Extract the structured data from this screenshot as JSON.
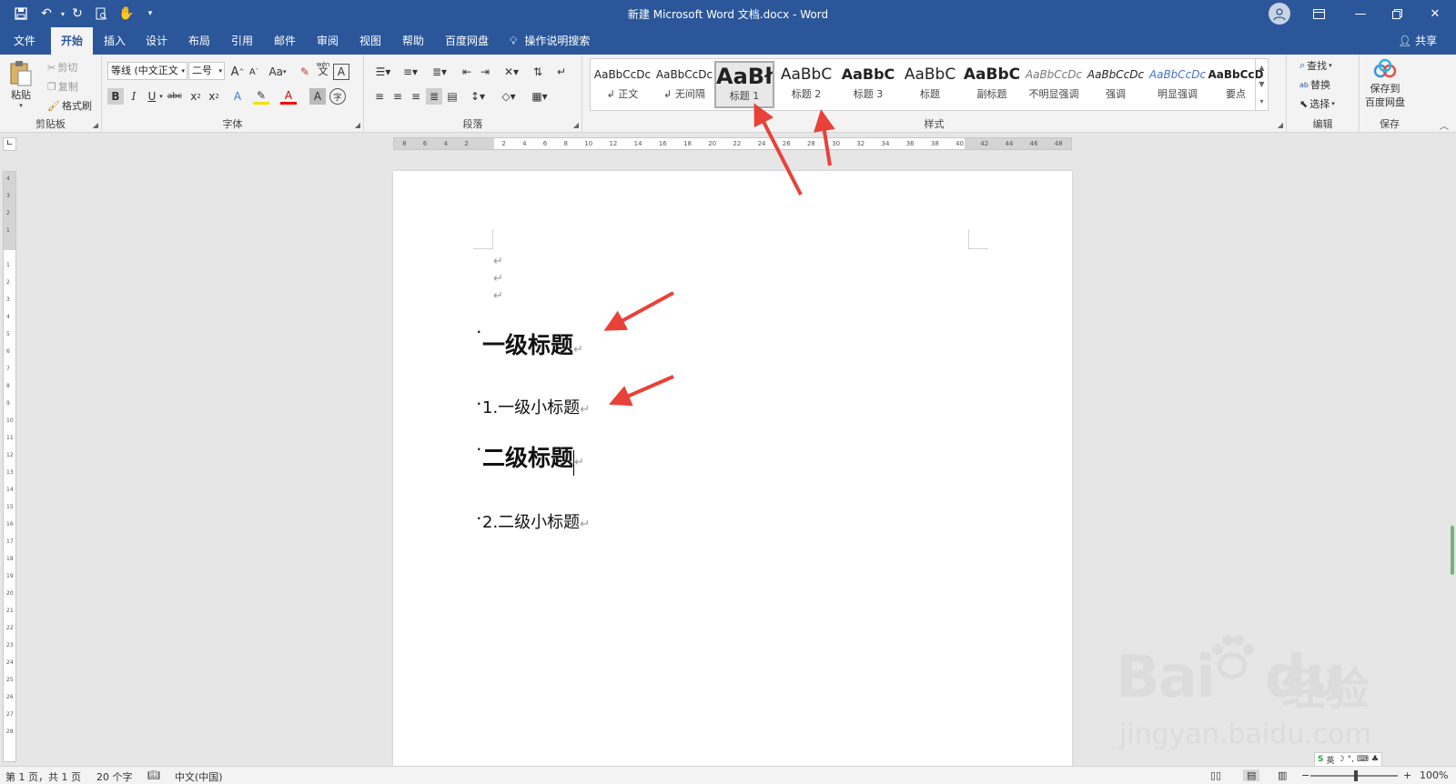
{
  "window": {
    "title": "新建 Microsoft Word 文档.docx  -  Word",
    "quick_access": [
      "save-icon",
      "undo-icon",
      "redo-icon",
      "print-preview-icon",
      "touch-mode-icon",
      "customize-icon"
    ],
    "controls": [
      "ribbon-display-icon",
      "minimize-icon",
      "restore-icon",
      "close-icon"
    ]
  },
  "tabs": [
    {
      "label": "文件"
    },
    {
      "label": "开始"
    },
    {
      "label": "插入"
    },
    {
      "label": "设计"
    },
    {
      "label": "布局"
    },
    {
      "label": "引用"
    },
    {
      "label": "邮件"
    },
    {
      "label": "审阅"
    },
    {
      "label": "视图"
    },
    {
      "label": "帮助"
    },
    {
      "label": "百度网盘"
    }
  ],
  "active_tab": "开始",
  "tell_me": "操作说明搜索",
  "share": "共享",
  "ribbon": {
    "clipboard": {
      "label": "剪贴板",
      "paste": "粘贴",
      "cut": "剪切",
      "copy": "复制",
      "format_painter": "格式刷"
    },
    "font": {
      "label": "字体",
      "font_name": "等线 (中文正文",
      "font_size": "二号",
      "grow": "A",
      "shrink": "A",
      "case": "Aa",
      "bold": "B",
      "italic": "I",
      "underline": "U",
      "strike": "abc",
      "sub": "x",
      "sub2": "2",
      "sup": "x",
      "sup2": "2",
      "pinyin_top": "wén",
      "pinyin_bot": "文",
      "clear": "A",
      "border_char": "A",
      "shade_char": "A",
      "enclose": "字"
    },
    "paragraph": {
      "label": "段落"
    },
    "styles": {
      "label": "样式",
      "items": [
        {
          "sample": "AaBbCcDc",
          "name": "正文",
          "selected": false
        },
        {
          "sample": "AaBbCcDc",
          "name": "无间隔",
          "selected": false
        },
        {
          "sample": "AaBł",
          "name": "标题 1",
          "selected": true
        },
        {
          "sample": "AaBbC",
          "name": "标题 2",
          "selected": false
        },
        {
          "sample": "AaBbC",
          "name": "标题 3",
          "selected": false
        },
        {
          "sample": "AaBbC",
          "name": "标题",
          "selected": false
        },
        {
          "sample": "AaBbC",
          "name": "副标题",
          "selected": false
        },
        {
          "sample": "AaBbCcDc",
          "name": "不明显强调",
          "selected": false
        },
        {
          "sample": "AaBbCcDc",
          "name": "强调",
          "selected": false
        },
        {
          "sample": "AaBbCcDc",
          "name": "明显强调",
          "selected": false
        },
        {
          "sample": "AaBbCcD",
          "name": "要点",
          "selected": false
        }
      ]
    },
    "editing": {
      "label": "编辑",
      "find": "查找",
      "replace": "替换",
      "select": "选择"
    },
    "save": {
      "label": "保存",
      "button": "保存到\n百度网盘",
      "line1": "保存到",
      "line2": "百度网盘"
    }
  },
  "ruler": {
    "h_ticks": [
      "8",
      "6",
      "4",
      "2",
      "",
      "2",
      "4",
      "6",
      "8",
      "10",
      "12",
      "14",
      "16",
      "18",
      "20",
      "22",
      "24",
      "26",
      "28",
      "30",
      "32",
      "34",
      "36",
      "38",
      "40",
      "42",
      "44",
      "46",
      "48"
    ],
    "v_ticks": [
      "4",
      "3",
      "2",
      "1",
      "",
      "1",
      "2",
      "3",
      "4",
      "5",
      "6",
      "7",
      "8",
      "9",
      "10",
      "11",
      "12",
      "13",
      "14",
      "15",
      "16",
      "17",
      "18",
      "19",
      "20",
      "21",
      "22",
      "23",
      "24",
      "25",
      "26",
      "27",
      "28"
    ]
  },
  "document": {
    "paragraphs": [
      {
        "text": "一级标题",
        "style": "h1",
        "bullet": "·"
      },
      {
        "text": "1.一级小标题",
        "style": "h2",
        "bullet": "."
      },
      {
        "text": "二级标题",
        "style": "h1",
        "bullet": "."
      },
      {
        "text": "2.二级小标题",
        "style": "h2",
        "bullet": "."
      }
    ],
    "paragraph_mark": "↵"
  },
  "status": {
    "page": "第 1 页，共 1 页",
    "words": "20 个字",
    "language": "中文(中国)",
    "zoom": "100%"
  },
  "watermark": {
    "brand": "Bai",
    "brand2": "du",
    "cn": "经验",
    "url": "jingyan.baidu.com"
  },
  "ime": {
    "label": "英"
  },
  "colors": {
    "title_bar": "#2b579a",
    "ribbon": "#f3f3f3",
    "arrow": "#e8413a"
  }
}
